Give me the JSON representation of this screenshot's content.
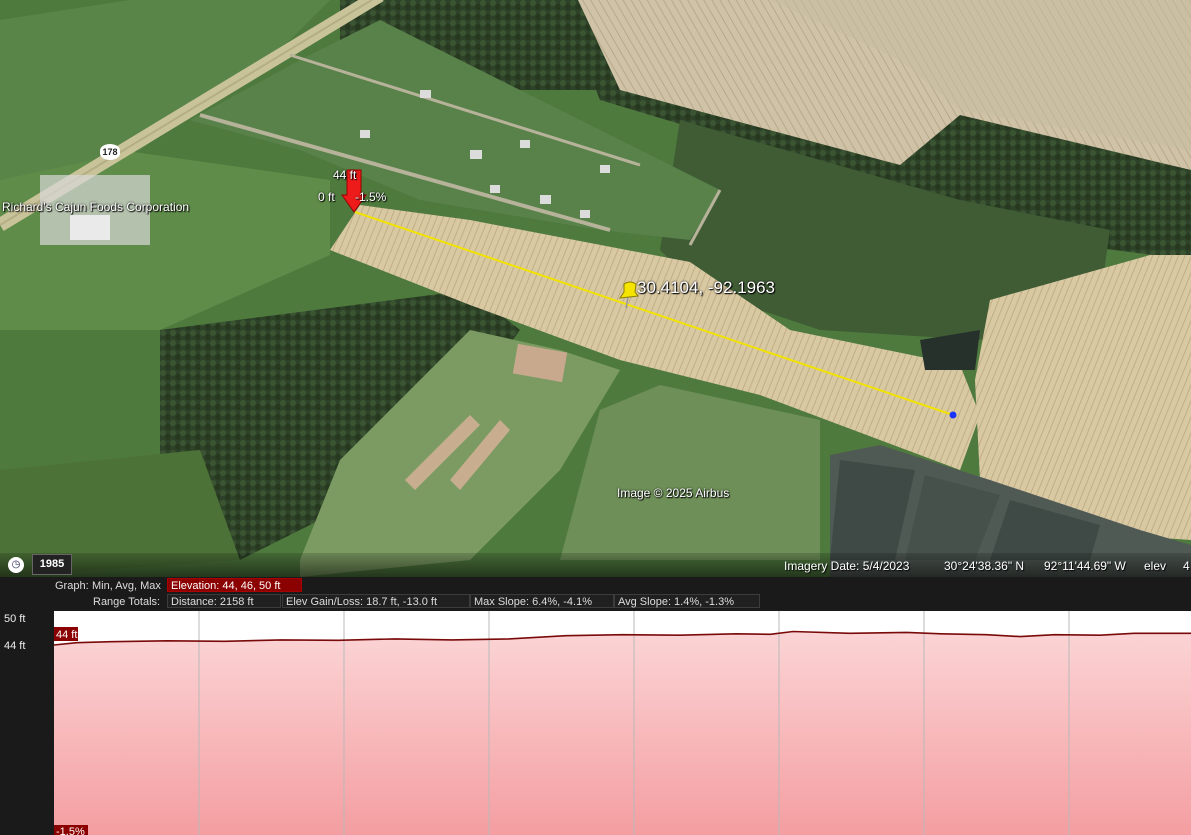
{
  "map": {
    "place_label": "Richard's Cajun Foods Corporation",
    "road_sign": "178",
    "marker": {
      "elevation": "44 ft",
      "left_value": "0 ft",
      "right_value": "-1.5%"
    },
    "coordinate_label": "30.4104, -92.1963",
    "copyright": "Image © 2025 Airbus",
    "history_icon": "clock-icon",
    "history_year": "1985",
    "status": {
      "imagery_date": "Imagery Date: 5/4/2023",
      "lat": "30°24'38.36\" N",
      "lon": "92°11'44.69\" W",
      "elev": "elev",
      "cut": "4"
    }
  },
  "profile": {
    "graph_label": "Graph:",
    "graph_options": "Min, Avg, Max",
    "elevation": "Elevation: 44, 46, 50 ft",
    "range_label": "Range Totals:",
    "distance": "Distance: 2158 ft",
    "gain_loss": "Elev Gain/Loss: 18.7 ft, -13.0 ft",
    "max_slope": "Max Slope: 6.4%, -4.1%",
    "avg_slope": "Avg Slope: 1.4%, -1.3%",
    "y_top": "50 ft",
    "y_bottom": "44 ft",
    "pointer_elev": "44 ft",
    "pointer_slope": "-1.5%",
    "colors": {
      "fill": "#f6a8aa",
      "line": "#7a0a0a",
      "active": "#8b0000"
    }
  },
  "chart_data": {
    "type": "area",
    "ylim": [
      44,
      50
    ],
    "x": [
      0,
      0.02,
      0.05,
      0.1,
      0.15,
      0.2,
      0.25,
      0.3,
      0.35,
      0.4,
      0.45,
      0.5,
      0.55,
      0.6,
      0.63,
      0.65,
      0.7,
      0.75,
      0.78,
      0.82,
      0.85,
      0.88,
      0.92,
      0.95,
      1.0
    ],
    "y": [
      44.0,
      44.5,
      44.7,
      44.9,
      44.8,
      45.1,
      45.0,
      45.3,
      45.1,
      45.3,
      46.0,
      46.2,
      46.1,
      46.4,
      46.3,
      46.9,
      46.5,
      46.7,
      46.4,
      46.2,
      45.8,
      46.2,
      46.1,
      46.5,
      46.5
    ]
  }
}
